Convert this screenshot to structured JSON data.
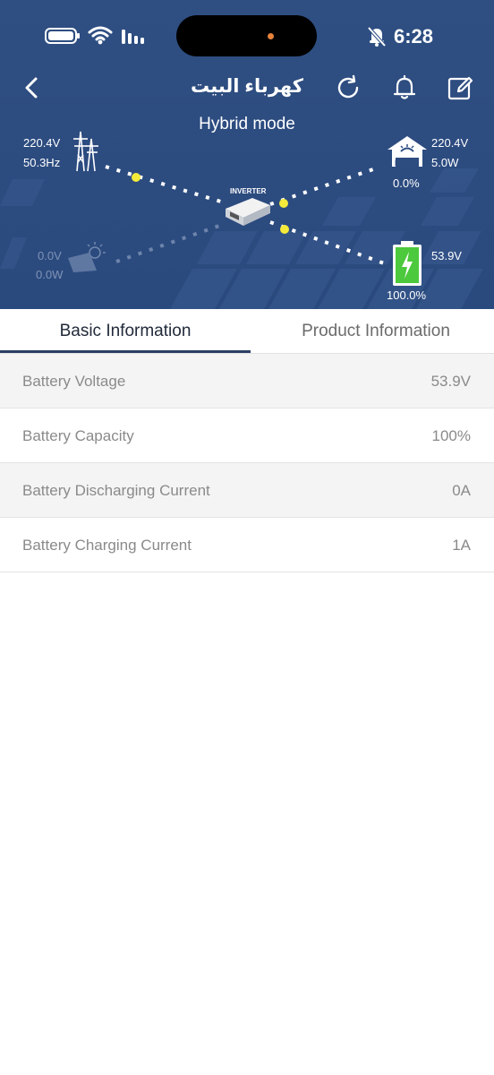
{
  "status_bar": {
    "time": "6:28"
  },
  "nav": {
    "title": "كهرباء البيت"
  },
  "mode": "Hybrid mode",
  "grid": {
    "voltage": "220.4V",
    "frequency": "50.3Hz"
  },
  "load": {
    "voltage": "220.4V",
    "power": "5.0W",
    "percent": "0.0%",
    "icon_label": "LOAD"
  },
  "pv": {
    "voltage": "0.0V",
    "power": "0.0W"
  },
  "battery": {
    "voltage": "53.9V",
    "percent": "100.0%"
  },
  "inverter": {
    "label": "INVERTER"
  },
  "tabs": [
    {
      "label": "Basic Information",
      "active": true
    },
    {
      "label": "Product Information",
      "active": false
    }
  ],
  "rows": [
    {
      "label": "Battery Voltage",
      "value": "53.9V"
    },
    {
      "label": "Battery Capacity",
      "value": "100%"
    },
    {
      "label": "Battery Discharging Current",
      "value": "0A"
    },
    {
      "label": "Battery Charging Current",
      "value": "1A"
    }
  ],
  "colors": {
    "hero_bg": "#2d4c80",
    "flow_dot": "#f4ea3a",
    "battery_green": "#4cc93c",
    "tab_accent": "#2b3e63"
  }
}
